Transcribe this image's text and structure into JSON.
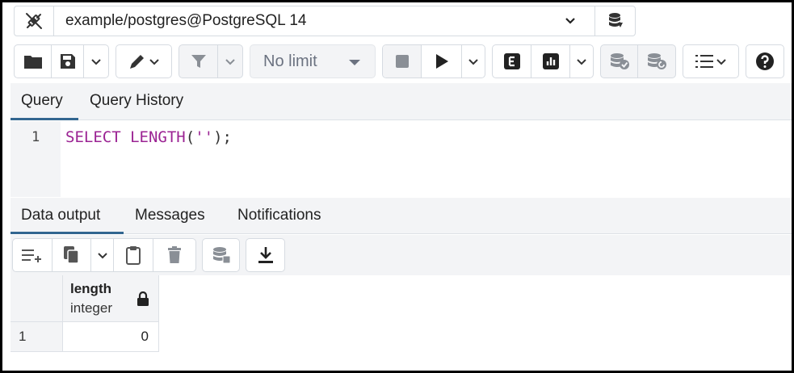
{
  "connection": {
    "label": "example/postgres@PostgreSQL 14"
  },
  "toolbar": {
    "limit_label": "No limit"
  },
  "editor_tabs": {
    "query": "Query",
    "history": "Query History"
  },
  "editor": {
    "line_number": "1",
    "code": {
      "kw_select": "SELECT",
      "func": "LENGTH",
      "open_paren": "(",
      "string": "''",
      "close": ");"
    }
  },
  "result_tabs": {
    "data_output": "Data output",
    "messages": "Messages",
    "notifications": "Notifications"
  },
  "grid": {
    "columns": [
      {
        "name": "length",
        "type": "integer"
      }
    ],
    "rows": [
      {
        "num": "1",
        "values": [
          "0"
        ]
      }
    ]
  },
  "colors": {
    "accent": "#326690",
    "keyword": "#9b2393",
    "panel_bg": "#f3f4f6"
  }
}
